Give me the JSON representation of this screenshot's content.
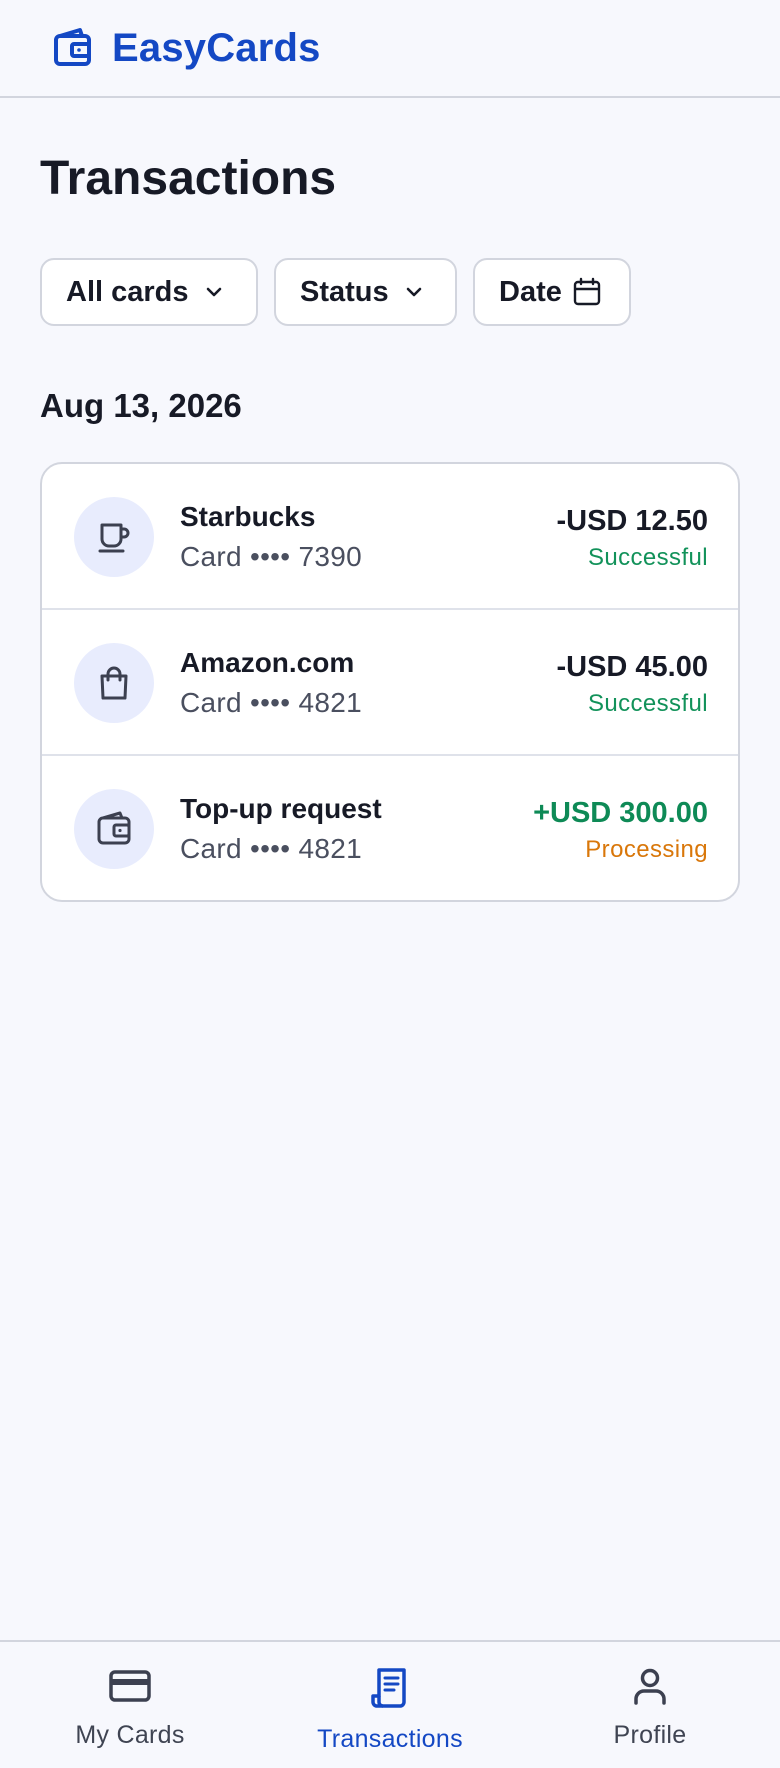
{
  "app": {
    "name": "EasyCards",
    "accent_color": "#1448c4"
  },
  "page": {
    "title": "Transactions"
  },
  "filters": {
    "cards_label": "All cards",
    "status_label": "Status",
    "date_label": "Date"
  },
  "groups": [
    {
      "date": "Aug 13, 2026",
      "transactions": [
        {
          "merchant": "Starbucks",
          "card": "Card •••• 7390",
          "amount": "-USD 12.50",
          "status": "Successful",
          "icon": "coffee-cup-icon"
        },
        {
          "merchant": "Amazon.com",
          "card": "Card •••• 4821",
          "amount": "-USD 45.00",
          "status": "Successful",
          "icon": "shopping-bag-icon"
        },
        {
          "merchant": "Top-up request",
          "card": "Card •••• 4821",
          "amount": "+USD 300.00",
          "status": "Processing",
          "icon": "wallet-icon"
        }
      ]
    }
  ],
  "status_colors": {
    "Successful": "#12925a",
    "Processing": "#d9770a",
    "credit": "#0e8a56"
  },
  "nav": {
    "items": [
      {
        "label": "My Cards",
        "icon": "credit-card-icon",
        "active": false
      },
      {
        "label": "Transactions",
        "icon": "receipt-icon",
        "active": true
      },
      {
        "label": "Profile",
        "icon": "person-icon",
        "active": false
      }
    ]
  }
}
